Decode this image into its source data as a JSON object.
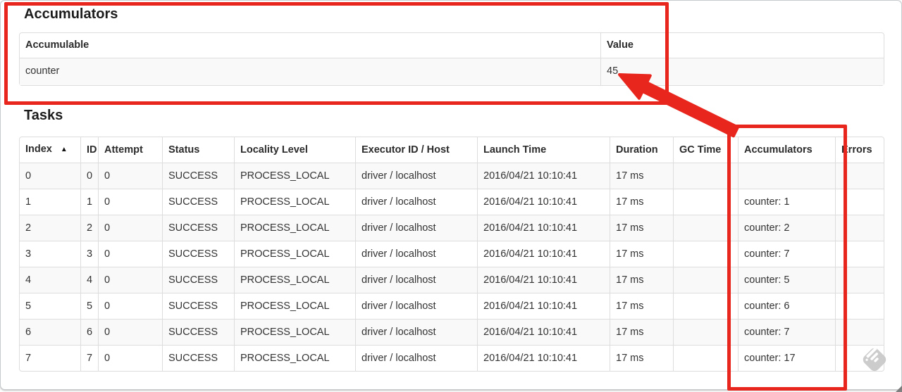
{
  "annotation": {
    "color": "#e8261d"
  },
  "accumulators_section": {
    "title": "Accumulators",
    "table": {
      "headers": {
        "accumulable": "Accumulable",
        "value": "Value"
      },
      "row": {
        "accumulable": "counter",
        "value": "45"
      }
    }
  },
  "tasks_section": {
    "title": "Tasks",
    "table": {
      "headers": [
        "Index",
        "ID",
        "Attempt",
        "Status",
        "Locality Level",
        "Executor ID / Host",
        "Launch Time",
        "Duration",
        "GC Time",
        "Accumulators",
        "Errors"
      ],
      "sort_column": 0,
      "sort_icon": "▲",
      "rows": [
        [
          "0",
          "0",
          "0",
          "SUCCESS",
          "PROCESS_LOCAL",
          "driver / localhost",
          "2016/04/21 10:10:41",
          "17 ms",
          "",
          "",
          ""
        ],
        [
          "1",
          "1",
          "0",
          "SUCCESS",
          "PROCESS_LOCAL",
          "driver / localhost",
          "2016/04/21 10:10:41",
          "17 ms",
          "",
          "counter: 1",
          ""
        ],
        [
          "2",
          "2",
          "0",
          "SUCCESS",
          "PROCESS_LOCAL",
          "driver / localhost",
          "2016/04/21 10:10:41",
          "17 ms",
          "",
          "counter: 2",
          ""
        ],
        [
          "3",
          "3",
          "0",
          "SUCCESS",
          "PROCESS_LOCAL",
          "driver / localhost",
          "2016/04/21 10:10:41",
          "17 ms",
          "",
          "counter: 7",
          ""
        ],
        [
          "4",
          "4",
          "0",
          "SUCCESS",
          "PROCESS_LOCAL",
          "driver / localhost",
          "2016/04/21 10:10:41",
          "17 ms",
          "",
          "counter: 5",
          ""
        ],
        [
          "5",
          "5",
          "0",
          "SUCCESS",
          "PROCESS_LOCAL",
          "driver / localhost",
          "2016/04/21 10:10:41",
          "17 ms",
          "",
          "counter: 6",
          ""
        ],
        [
          "6",
          "6",
          "0",
          "SUCCESS",
          "PROCESS_LOCAL",
          "driver / localhost",
          "2016/04/21 10:10:41",
          "17 ms",
          "",
          "counter: 7",
          ""
        ],
        [
          "7",
          "7",
          "0",
          "SUCCESS",
          "PROCESS_LOCAL",
          "driver / localhost",
          "2016/04/21 10:10:41",
          "17 ms",
          "",
          "counter: 17",
          ""
        ]
      ]
    }
  }
}
